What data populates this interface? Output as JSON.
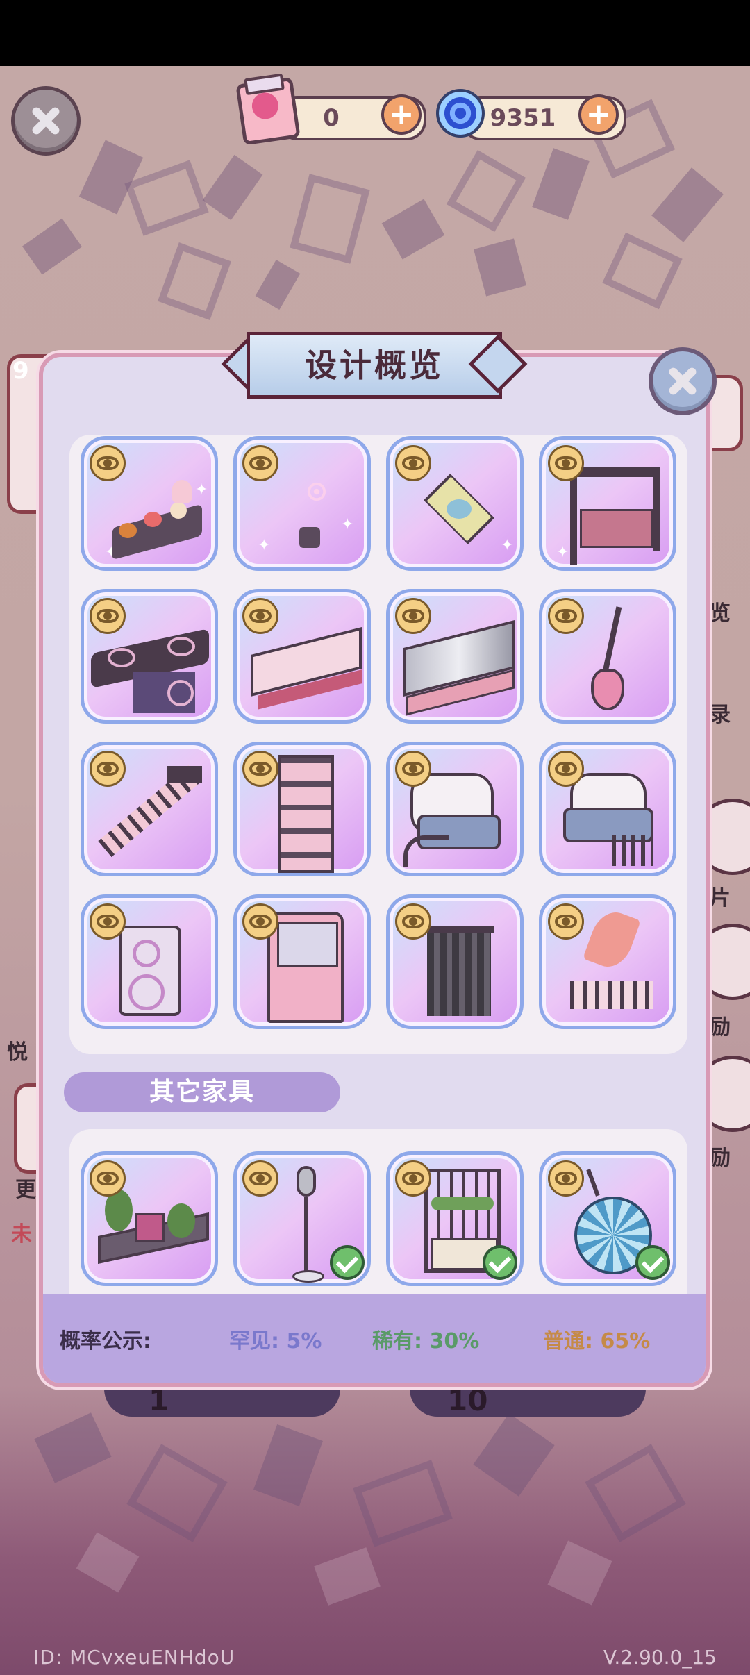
{
  "currency": {
    "tickets": "0",
    "gems": "9351",
    "plus_symbol": "+"
  },
  "modal": {
    "title": "设计概览",
    "section_other": "其它家具",
    "probability": {
      "label": "概率公示:",
      "rare": "罕见: 5%",
      "uncommon": "稀有: 30%",
      "common": "普通: 65%"
    }
  },
  "background": {
    "side_labels": [
      "览",
      "录",
      "片",
      "励",
      "励",
      "悦",
      "更",
      "未"
    ],
    "side_number": "9",
    "draw_counts": [
      "1",
      "10"
    ]
  },
  "footer": {
    "id": "ID: MCvxeuENHdoU",
    "version": "V.2.90.0_15"
  },
  "colors": {
    "rare": "#7a78cc",
    "uncommon": "#5a9a68",
    "common": "#c58a48",
    "card_border": "#8ea8ea"
  },
  "items": [
    {
      "name": "buffet-table",
      "owned": false
    },
    {
      "name": "bubble-machine",
      "owned": false
    },
    {
      "name": "patterned-rug",
      "owned": false
    },
    {
      "name": "stage-truss",
      "owned": false
    },
    {
      "name": "dj-booth",
      "owned": false
    },
    {
      "name": "runway-platform",
      "owned": false
    },
    {
      "name": "stage-platform",
      "owned": false
    },
    {
      "name": "electric-guitar",
      "owned": false
    },
    {
      "name": "staircase",
      "owned": false
    },
    {
      "name": "shelf-tower",
      "owned": false
    },
    {
      "name": "lounge-chair-left",
      "owned": false
    },
    {
      "name": "lounge-chair-right",
      "owned": false
    },
    {
      "name": "speaker",
      "owned": false
    },
    {
      "name": "claw-machine",
      "owned": false
    },
    {
      "name": "curtain-backdrop",
      "owned": false
    },
    {
      "name": "plant-planter",
      "owned": false
    }
  ],
  "other_items": [
    {
      "name": "plant-bench",
      "owned": false
    },
    {
      "name": "microphone-stand",
      "owned": true
    },
    {
      "name": "flower-stall",
      "owned": true
    },
    {
      "name": "disco-ball",
      "owned": true
    }
  ]
}
